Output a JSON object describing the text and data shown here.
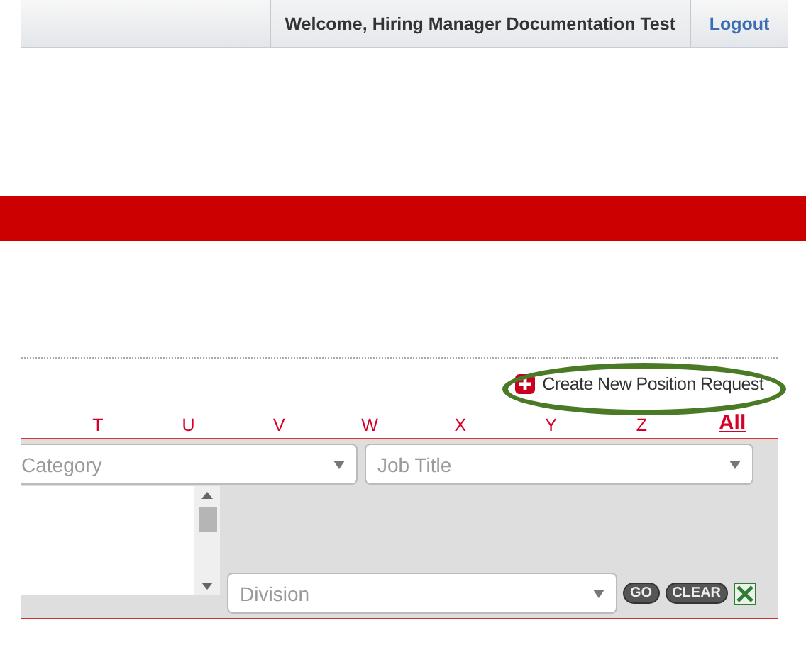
{
  "header": {
    "welcome": "Welcome, Hiring Manager Documentation Test",
    "logout": "Logout"
  },
  "create_request": {
    "label": "Create New Position Request"
  },
  "letters": [
    {
      "label": "T",
      "selected": false
    },
    {
      "label": "U",
      "selected": false
    },
    {
      "label": "V",
      "selected": false
    },
    {
      "label": "W",
      "selected": false
    },
    {
      "label": "X",
      "selected": false
    },
    {
      "label": "Y",
      "selected": false
    },
    {
      "label": "Z",
      "selected": false
    },
    {
      "label": "All",
      "selected": true
    }
  ],
  "filters": {
    "category": {
      "placeholder": "Category"
    },
    "job_title": {
      "placeholder": "Job Title"
    },
    "division": {
      "placeholder": "Division"
    }
  },
  "buttons": [
    {
      "label": "GO"
    },
    {
      "label": "CLEAR"
    }
  ]
}
